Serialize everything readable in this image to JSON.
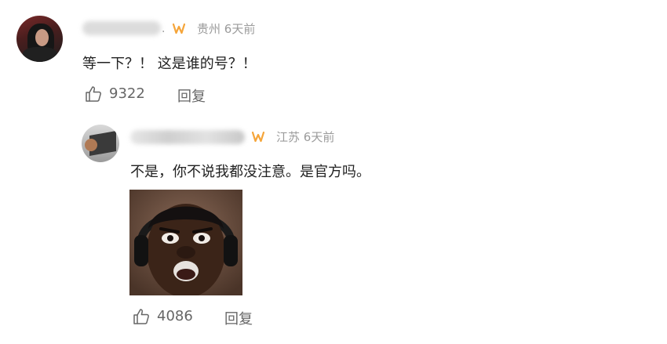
{
  "comments": [
    {
      "location": "贵州",
      "time": "6天前",
      "text": "等一下？！ 这是谁的号？！",
      "likes": "9322",
      "reply_label": "回复",
      "badge_icon": "orange-w-badge-icon",
      "name_suffix": "."
    },
    {
      "location": "江苏",
      "time": "6天前",
      "text": "不是，你不说我都没注意。是官方吗。",
      "likes": "4086",
      "reply_label": "回复",
      "badge_icon": "orange-w-badge-icon",
      "attachment_icon": "shocked-face-reaction-image"
    }
  ],
  "colors": {
    "badge": "#f5a53a",
    "meta_text": "#9b9b9b",
    "action_text": "#666666",
    "body_text": "#222222"
  }
}
